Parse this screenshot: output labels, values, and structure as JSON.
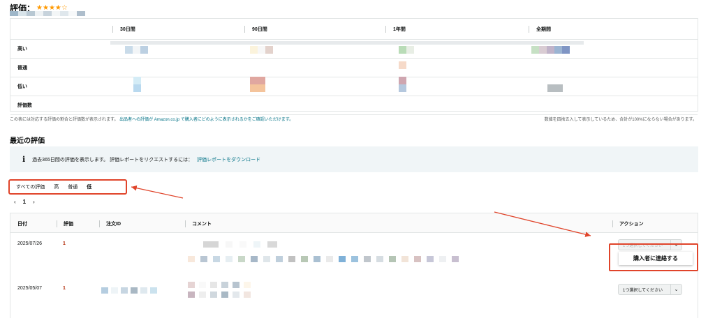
{
  "header": {
    "title": "評価：",
    "stars": "★★★★☆"
  },
  "stats_table": {
    "columns": [
      "30日間",
      "90日間",
      "1年間",
      "全期間"
    ],
    "rows": [
      "高い",
      "普通",
      "低い",
      "評価数"
    ]
  },
  "notes": {
    "left_prefix": "この表には対応する評価の割合と評価数が表示されます。",
    "left_link": "出品者への評価が Amazon.co.jp で購入者にどのように表示されるかをご確認いただけます。",
    "right": "数値を四捨五入して表示しているため、合計が100%にならない場合があります。"
  },
  "recent": {
    "title": "最近の評価",
    "info_icon": "i",
    "info_text": "過去365日間の評価を表示します。 評価レポートをリクエストするには：",
    "info_link": "評価レポートをダウンロード"
  },
  "filters": [
    "すべての評価",
    "高",
    "普通",
    "低"
  ],
  "pager": {
    "prev": "‹",
    "current": "1",
    "next": "›"
  },
  "reviews_table": {
    "headers": [
      "日付",
      "評価",
      "注文ID",
      "コメント",
      "アクション"
    ],
    "rows": [
      {
        "date": "2025/07/26",
        "rating": "1",
        "action": "1つ選択してください"
      },
      {
        "date": "2025/05/07",
        "rating": "1",
        "action": "1つ選択してください"
      }
    ]
  },
  "dropdown_option": "購入者に連絡する",
  "colors": {
    "link": "#007185",
    "star": "#ff9900",
    "rating_low": "#b12704",
    "annotation": "#e0442a"
  }
}
